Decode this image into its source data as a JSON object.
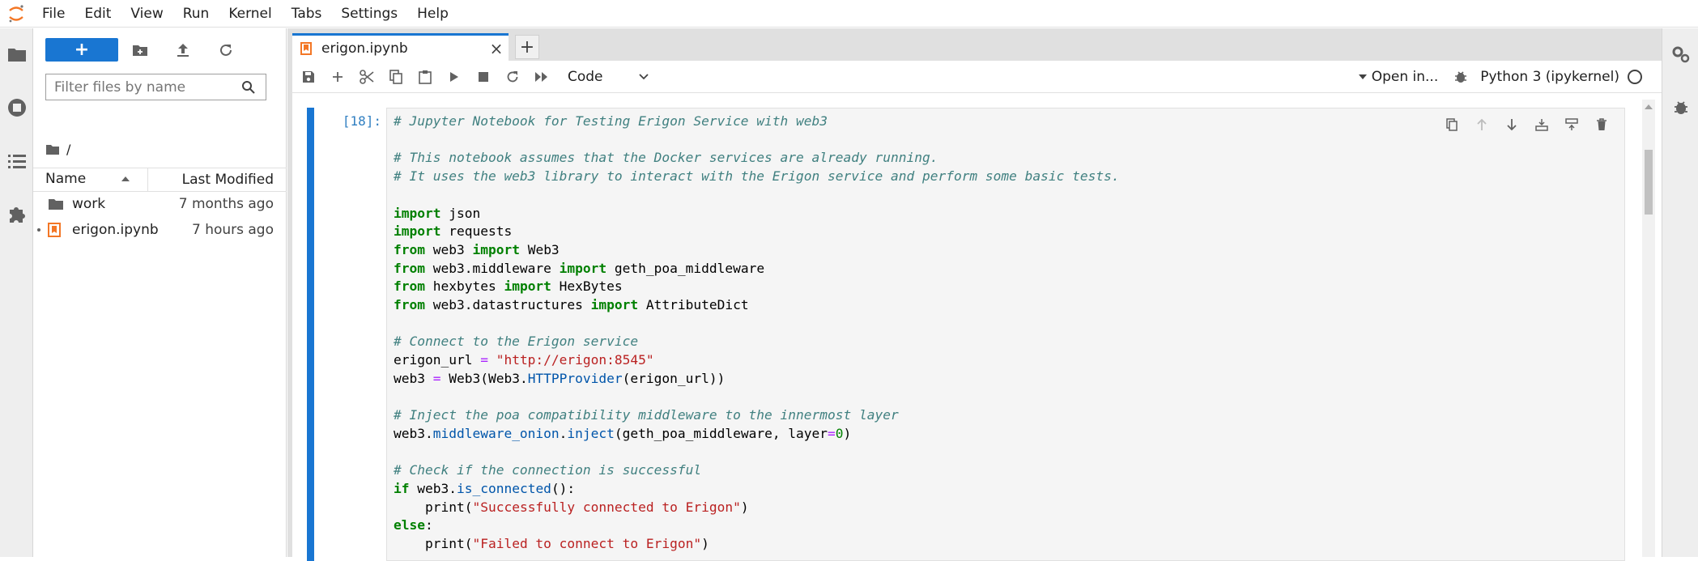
{
  "menu": [
    "File",
    "Edit",
    "View",
    "Run",
    "Kernel",
    "Tabs",
    "Settings",
    "Help"
  ],
  "filebrowser": {
    "new_label": "+",
    "filter_placeholder": "Filter files by name",
    "breadcrumb": "/",
    "columns": {
      "name": "Name",
      "modified": "Last Modified"
    },
    "rows": [
      {
        "name": "work",
        "modified": "7 months ago",
        "type": "folder"
      },
      {
        "name": "erigon.ipynb",
        "modified": "7 hours ago",
        "type": "notebook"
      }
    ]
  },
  "tab": {
    "label": "erigon.ipynb",
    "close": "×",
    "add": "+"
  },
  "toolbar": {
    "cell_type": "Code",
    "open_in": "Open in...",
    "kernel": "Python 3 (ipykernel)"
  },
  "cell": {
    "prompt": "[18]:"
  },
  "colors": {
    "accent": "#1976d2",
    "comment": "#408080",
    "keyword": "#008000",
    "string": "#ba2121"
  }
}
